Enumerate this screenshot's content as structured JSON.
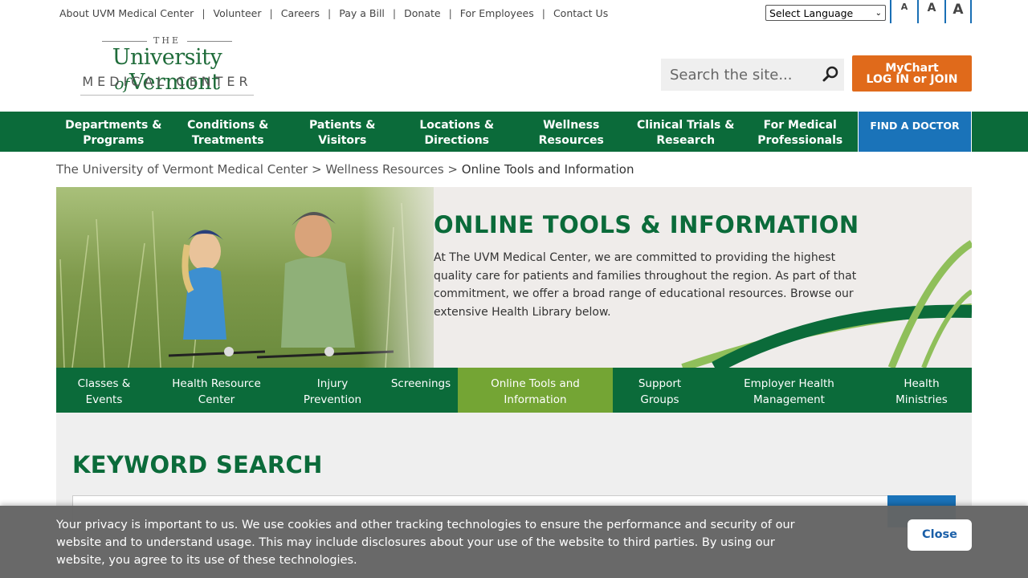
{
  "utility": {
    "links": [
      "About UVM Medical Center",
      "Volunteer",
      "Careers",
      "Pay a Bill",
      "Donate",
      "For Employees",
      "Contact Us"
    ],
    "separator": "|",
    "language_select": "Select Language",
    "text_size": [
      "A",
      "A",
      "A"
    ]
  },
  "logo": {
    "the": "THE",
    "university": "University",
    "of": "of",
    "vermont": "Vermont",
    "medical_center": "MEDICAL CENTER"
  },
  "header": {
    "search_placeholder": "Search the site...",
    "mychart_line1": "MyChart",
    "mychart_line2": "LOG IN or JOIN"
  },
  "nav": {
    "items": [
      {
        "line1": "Departments &",
        "line2": "Programs"
      },
      {
        "line1": "Conditions &",
        "line2": "Treatments"
      },
      {
        "line1": "Patients &",
        "line2": "Visitors"
      },
      {
        "line1": "Locations &",
        "line2": "Directions"
      },
      {
        "line1": "Wellness",
        "line2": "Resources"
      },
      {
        "line1": "Clinical Trials &",
        "line2": "Research"
      },
      {
        "line1": "For Medical",
        "line2": "Professionals"
      }
    ],
    "find_doctor": "FIND A DOCTOR"
  },
  "breadcrumb": {
    "items": [
      "The University of Vermont Medical Center",
      "Wellness Resources",
      "Online Tools and Information"
    ],
    "separator": ">"
  },
  "hero": {
    "title": "ONLINE TOOLS & INFORMATION",
    "text": "At The UVM Medical Center, we are committed to providing the highest quality care for patients and families throughout the region. As part of that commitment, we offer a broad range of educational resources. Browse our extensive Health Library below."
  },
  "subnav": {
    "items": [
      {
        "line1": "Classes &",
        "line2": "Events"
      },
      {
        "line1": "Health Resource",
        "line2": "Center"
      },
      {
        "line1": "Injury",
        "line2": "Prevention"
      },
      {
        "line1": "Screenings",
        "line2": ""
      },
      {
        "line1": "Online Tools and",
        "line2": "Information"
      },
      {
        "line1": "Support",
        "line2": "Groups"
      },
      {
        "line1": "Employer Health",
        "line2": "Management"
      },
      {
        "line1": "Health",
        "line2": "Ministries"
      }
    ]
  },
  "keyword": {
    "title": "KEYWORD SEARCH"
  },
  "cookie": {
    "text": "Your privacy is important to us. We use cookies and other tracking technologies to ensure the performance and security of our website and to understand usage. This may include disclosures about your use of the website to third parties. By using our website, you agree to its use of these technologies.",
    "close": "Close"
  },
  "colors": {
    "brand_green": "#0b6b3a",
    "accent_green": "#74a534",
    "orange": "#e06a1b",
    "blue": "#1a73b9"
  }
}
